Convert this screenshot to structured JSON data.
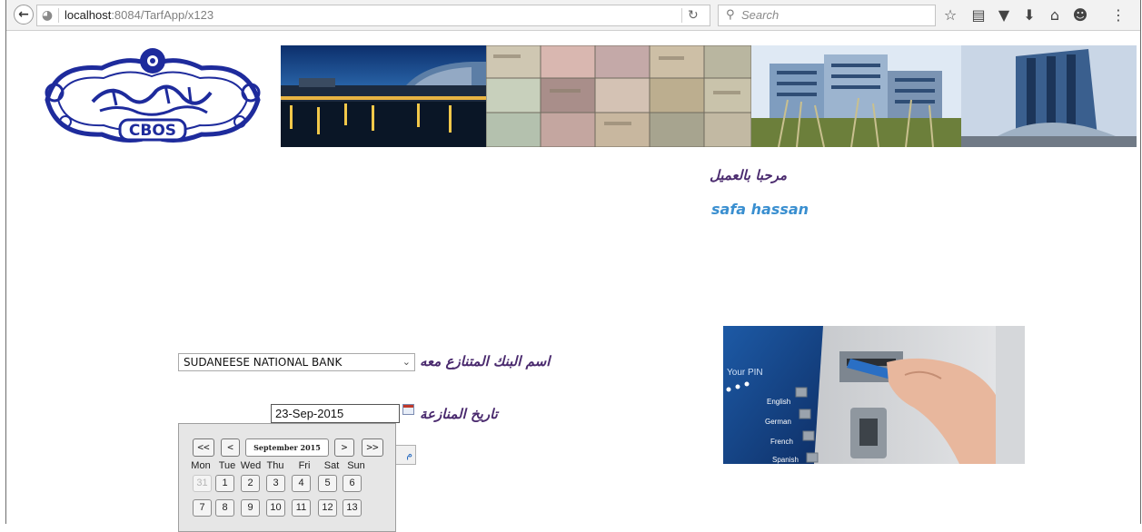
{
  "browser": {
    "url_host": "localhost",
    "url_path": ":8084/TarfApp/x123",
    "search_placeholder": "Search"
  },
  "header": {
    "logo_text": "CBOS"
  },
  "welcome": {
    "greeting": "مرحبا بالعميل",
    "user_name": "safa hassan"
  },
  "form": {
    "bank_label": "اسم البنك المتنازع معه",
    "bank_selected": "SUDANEESE NATIONAL BANK",
    "date_label": "تاريخ المنازعة",
    "date_value": "23-Sep-2015",
    "submit_peek": "م"
  },
  "calendar": {
    "prev_year": "<<",
    "prev_month": "<",
    "month_title": "September 2015",
    "next_month": ">",
    "next_year": ">>",
    "weekdays": [
      "Mon",
      "Tue",
      "Wed",
      "Thu",
      "Fri",
      "Sat",
      "Sun"
    ],
    "week1": [
      "31",
      "1",
      "2",
      "3",
      "4",
      "5",
      "6"
    ],
    "week2": [
      "7",
      "8",
      "9",
      "10",
      "11",
      "12",
      "13"
    ]
  },
  "atm": {
    "screen_title": "Your PIN",
    "options": [
      "English",
      "German",
      "French",
      "Spanish"
    ]
  }
}
